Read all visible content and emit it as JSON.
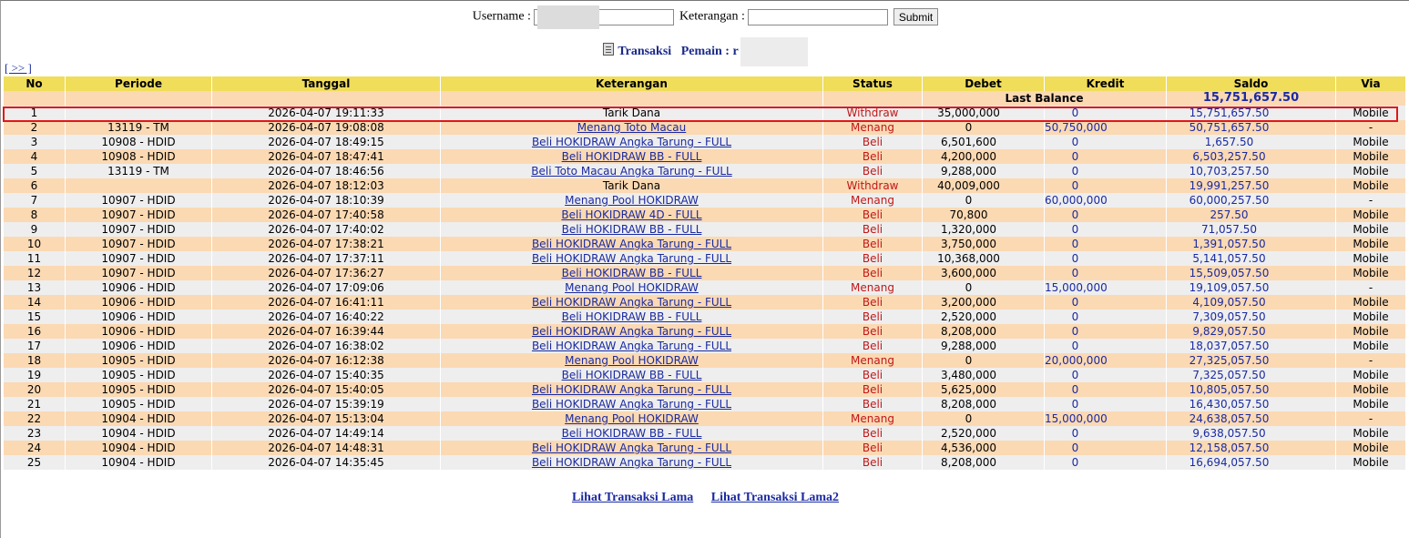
{
  "form": {
    "username_label": "Username :",
    "username_value": "r",
    "keterangan_label": "Keterangan :",
    "keterangan_value": "",
    "submit_label": "Submit"
  },
  "title": {
    "transaksi": "Transaksi",
    "pemain_label": "Pemain : r"
  },
  "nav": {
    "next_label": "[ >> ]"
  },
  "table": {
    "columns": [
      "No",
      "Periode",
      "Tanggal",
      "Keterangan",
      "Status",
      "Debet",
      "Kredit",
      "Saldo",
      "Via"
    ],
    "last_balance_label": "Last Balance",
    "last_balance_value": "15,751,657.50",
    "rows": [
      {
        "no": "1",
        "periode": "",
        "tanggal": "2026-04-07 19:11:33",
        "keterangan": "Tarik Dana",
        "link": false,
        "status": "Withdraw",
        "debet": "35,000,000",
        "kredit": "0",
        "saldo": "15,751,657.50",
        "via": "Mobile"
      },
      {
        "no": "2",
        "periode": "13119 - TM",
        "tanggal": "2026-04-07 19:08:08",
        "keterangan": "Menang Toto Macau",
        "link": true,
        "status": "Menang",
        "debet": "0",
        "kredit": "50,750,000",
        "saldo": "50,751,657.50",
        "via": "-"
      },
      {
        "no": "3",
        "periode": "10908 - HDID",
        "tanggal": "2026-04-07 18:49:15",
        "keterangan": "Beli HOKIDRAW Angka Tarung - FULL",
        "link": true,
        "status": "Beli",
        "debet": "6,501,600",
        "kredit": "0",
        "saldo": "1,657.50",
        "via": "Mobile"
      },
      {
        "no": "4",
        "periode": "10908 - HDID",
        "tanggal": "2026-04-07 18:47:41",
        "keterangan": "Beli HOKIDRAW BB - FULL",
        "link": true,
        "status": "Beli",
        "debet": "4,200,000",
        "kredit": "0",
        "saldo": "6,503,257.50",
        "via": "Mobile"
      },
      {
        "no": "5",
        "periode": "13119 - TM",
        "tanggal": "2026-04-07 18:46:56",
        "keterangan": "Beli Toto Macau Angka Tarung - FULL",
        "link": true,
        "status": "Beli",
        "debet": "9,288,000",
        "kredit": "0",
        "saldo": "10,703,257.50",
        "via": "Mobile"
      },
      {
        "no": "6",
        "periode": "",
        "tanggal": "2026-04-07 18:12:03",
        "keterangan": "Tarik Dana",
        "link": false,
        "status": "Withdraw",
        "debet": "40,009,000",
        "kredit": "0",
        "saldo": "19,991,257.50",
        "via": "Mobile"
      },
      {
        "no": "7",
        "periode": "10907 - HDID",
        "tanggal": "2026-04-07 18:10:39",
        "keterangan": "Menang Pool HOKIDRAW",
        "link": true,
        "status": "Menang",
        "debet": "0",
        "kredit": "60,000,000",
        "saldo": "60,000,257.50",
        "via": "-"
      },
      {
        "no": "8",
        "periode": "10907 - HDID",
        "tanggal": "2026-04-07 17:40:58",
        "keterangan": "Beli HOKIDRAW 4D - FULL",
        "link": true,
        "status": "Beli",
        "debet": "70,800",
        "kredit": "0",
        "saldo": "257.50",
        "via": "Mobile"
      },
      {
        "no": "9",
        "periode": "10907 - HDID",
        "tanggal": "2026-04-07 17:40:02",
        "keterangan": "Beli HOKIDRAW BB - FULL",
        "link": true,
        "status": "Beli",
        "debet": "1,320,000",
        "kredit": "0",
        "saldo": "71,057.50",
        "via": "Mobile"
      },
      {
        "no": "10",
        "periode": "10907 - HDID",
        "tanggal": "2026-04-07 17:38:21",
        "keterangan": "Beli HOKIDRAW Angka Tarung - FULL",
        "link": true,
        "status": "Beli",
        "debet": "3,750,000",
        "kredit": "0",
        "saldo": "1,391,057.50",
        "via": "Mobile"
      },
      {
        "no": "11",
        "periode": "10907 - HDID",
        "tanggal": "2026-04-07 17:37:11",
        "keterangan": "Beli HOKIDRAW Angka Tarung - FULL",
        "link": true,
        "status": "Beli",
        "debet": "10,368,000",
        "kredit": "0",
        "saldo": "5,141,057.50",
        "via": "Mobile"
      },
      {
        "no": "12",
        "periode": "10907 - HDID",
        "tanggal": "2026-04-07 17:36:27",
        "keterangan": "Beli HOKIDRAW BB - FULL",
        "link": true,
        "status": "Beli",
        "debet": "3,600,000",
        "kredit": "0",
        "saldo": "15,509,057.50",
        "via": "Mobile"
      },
      {
        "no": "13",
        "periode": "10906 - HDID",
        "tanggal": "2026-04-07 17:09:06",
        "keterangan": "Menang Pool HOKIDRAW",
        "link": true,
        "status": "Menang",
        "debet": "0",
        "kredit": "15,000,000",
        "saldo": "19,109,057.50",
        "via": "-"
      },
      {
        "no": "14",
        "periode": "10906 - HDID",
        "tanggal": "2026-04-07 16:41:11",
        "keterangan": "Beli HOKIDRAW Angka Tarung - FULL",
        "link": true,
        "status": "Beli",
        "debet": "3,200,000",
        "kredit": "0",
        "saldo": "4,109,057.50",
        "via": "Mobile"
      },
      {
        "no": "15",
        "periode": "10906 - HDID",
        "tanggal": "2026-04-07 16:40:22",
        "keterangan": "Beli HOKIDRAW BB - FULL",
        "link": true,
        "status": "Beli",
        "debet": "2,520,000",
        "kredit": "0",
        "saldo": "7,309,057.50",
        "via": "Mobile"
      },
      {
        "no": "16",
        "periode": "10906 - HDID",
        "tanggal": "2026-04-07 16:39:44",
        "keterangan": "Beli HOKIDRAW Angka Tarung - FULL",
        "link": true,
        "status": "Beli",
        "debet": "8,208,000",
        "kredit": "0",
        "saldo": "9,829,057.50",
        "via": "Mobile"
      },
      {
        "no": "17",
        "periode": "10906 - HDID",
        "tanggal": "2026-04-07 16:38:02",
        "keterangan": "Beli HOKIDRAW Angka Tarung - FULL",
        "link": true,
        "status": "Beli",
        "debet": "9,288,000",
        "kredit": "0",
        "saldo": "18,037,057.50",
        "via": "Mobile"
      },
      {
        "no": "18",
        "periode": "10905 - HDID",
        "tanggal": "2026-04-07 16:12:38",
        "keterangan": "Menang Pool HOKIDRAW",
        "link": true,
        "status": "Menang",
        "debet": "0",
        "kredit": "20,000,000",
        "saldo": "27,325,057.50",
        "via": "-"
      },
      {
        "no": "19",
        "periode": "10905 - HDID",
        "tanggal": "2026-04-07 15:40:35",
        "keterangan": "Beli HOKIDRAW BB - FULL",
        "link": true,
        "status": "Beli",
        "debet": "3,480,000",
        "kredit": "0",
        "saldo": "7,325,057.50",
        "via": "Mobile"
      },
      {
        "no": "20",
        "periode": "10905 - HDID",
        "tanggal": "2026-04-07 15:40:05",
        "keterangan": "Beli HOKIDRAW Angka Tarung - FULL",
        "link": true,
        "status": "Beli",
        "debet": "5,625,000",
        "kredit": "0",
        "saldo": "10,805,057.50",
        "via": "Mobile"
      },
      {
        "no": "21",
        "periode": "10905 - HDID",
        "tanggal": "2026-04-07 15:39:19",
        "keterangan": "Beli HOKIDRAW Angka Tarung - FULL",
        "link": true,
        "status": "Beli",
        "debet": "8,208,000",
        "kredit": "0",
        "saldo": "16,430,057.50",
        "via": "Mobile"
      },
      {
        "no": "22",
        "periode": "10904 - HDID",
        "tanggal": "2026-04-07 15:13:04",
        "keterangan": "Menang Pool HOKIDRAW",
        "link": true,
        "status": "Menang",
        "debet": "0",
        "kredit": "15,000,000",
        "saldo": "24,638,057.50",
        "via": "-"
      },
      {
        "no": "23",
        "periode": "10904 - HDID",
        "tanggal": "2026-04-07 14:49:14",
        "keterangan": "Beli HOKIDRAW BB - FULL",
        "link": true,
        "status": "Beli",
        "debet": "2,520,000",
        "kredit": "0",
        "saldo": "9,638,057.50",
        "via": "Mobile"
      },
      {
        "no": "24",
        "periode": "10904 - HDID",
        "tanggal": "2026-04-07 14:48:31",
        "keterangan": "Beli HOKIDRAW Angka Tarung - FULL",
        "link": true,
        "status": "Beli",
        "debet": "4,536,000",
        "kredit": "0",
        "saldo": "12,158,057.50",
        "via": "Mobile"
      },
      {
        "no": "25",
        "periode": "10904 - HDID",
        "tanggal": "2026-04-07 14:35:45",
        "keterangan": "Beli HOKIDRAW Angka Tarung - FULL",
        "link": true,
        "status": "Beli",
        "debet": "8,208,000",
        "kredit": "0",
        "saldo": "16,694,057.50",
        "via": "Mobile"
      }
    ]
  },
  "footer": {
    "link1": "Lihat Transaksi Lama",
    "link2": "Lihat Transaksi Lama2"
  },
  "colors": {
    "header_bg": "#f0dd5a",
    "row_even": "#fbd9b3",
    "row_odd": "#eeeeee",
    "link": "#1a2aa0",
    "status": "#c01818",
    "highlight_border": "#e01818"
  }
}
